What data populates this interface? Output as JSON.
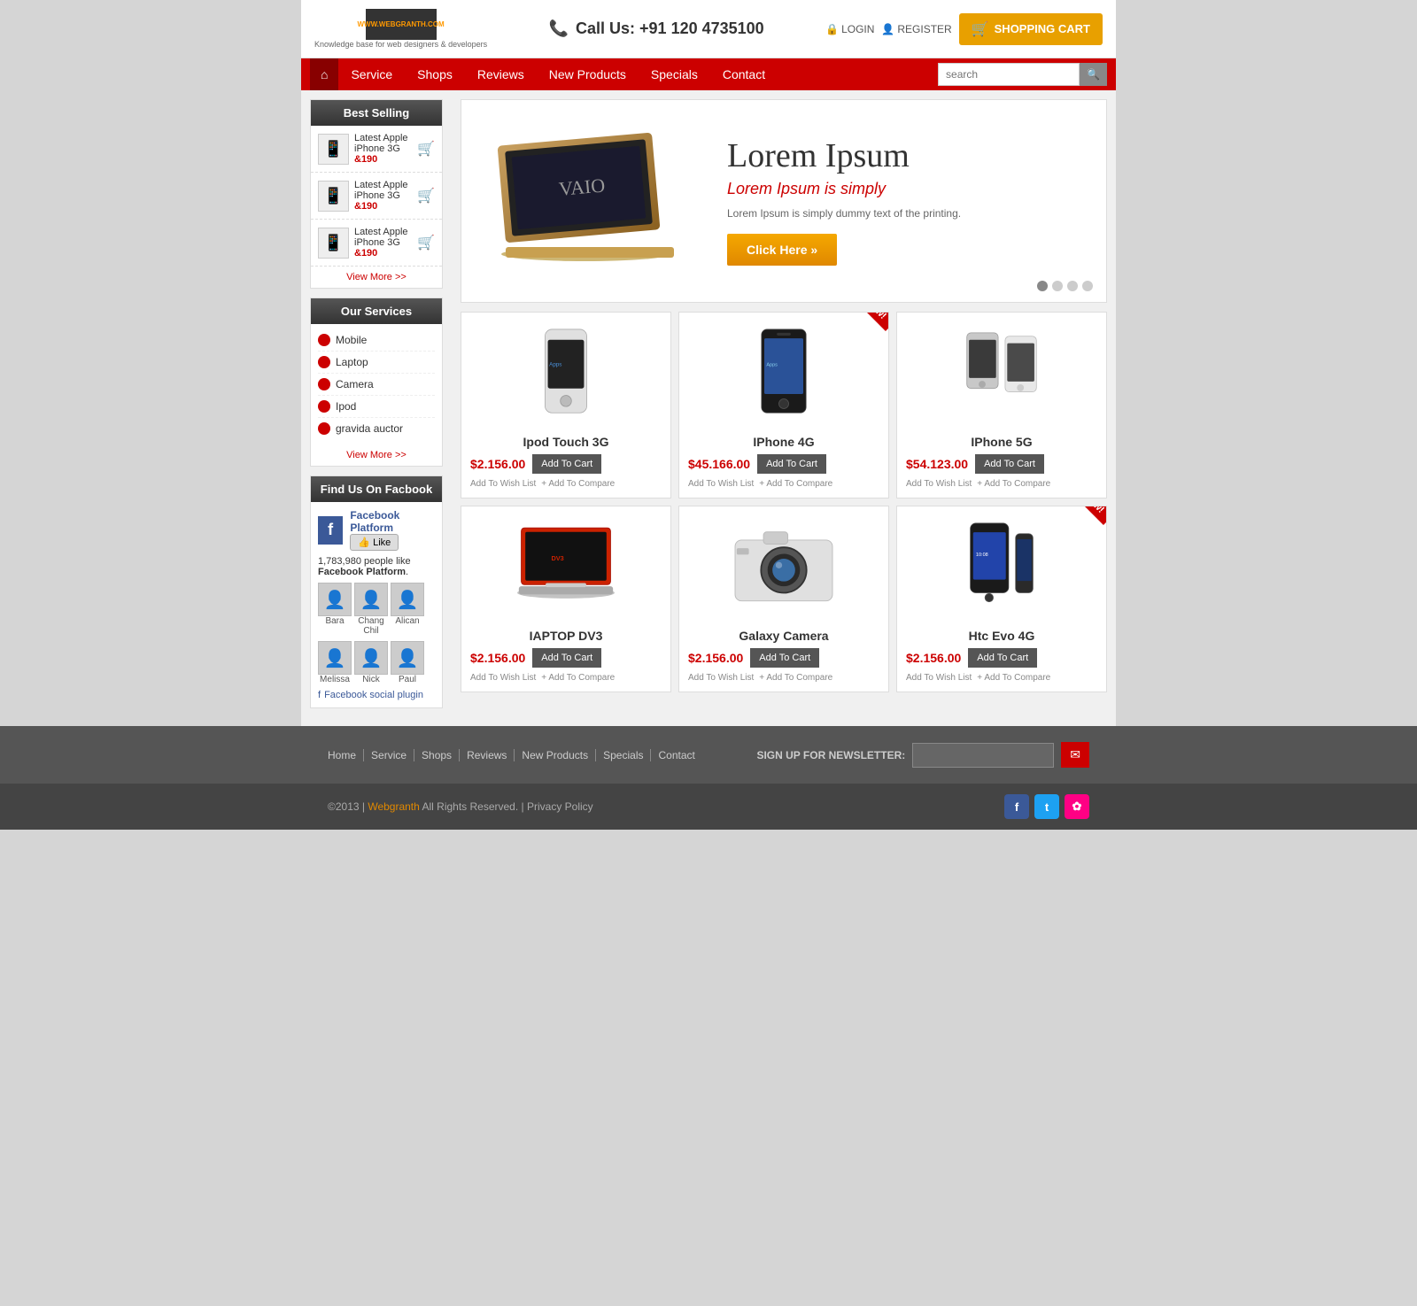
{
  "site": {
    "logo_text": "WWW.WEBGRANTH.COM",
    "logo_sub": "Knowledge base for web designers & developers",
    "phone_label": "Call Us:",
    "phone_number": "+91 120 4735100"
  },
  "header": {
    "login_label": "LOGIN",
    "register_label": "REGISTER",
    "cart_label": "SHOPPING CART"
  },
  "nav": {
    "home_label": "⌂",
    "items": [
      {
        "label": "Service",
        "href": "#"
      },
      {
        "label": "Shops",
        "href": "#"
      },
      {
        "label": "Reviews",
        "href": "#"
      },
      {
        "label": "New Products",
        "href": "#"
      },
      {
        "label": "Specials",
        "href": "#"
      },
      {
        "label": "Contact",
        "href": "#"
      }
    ],
    "search_placeholder": "search"
  },
  "sidebar": {
    "best_selling_title": "Best Selling",
    "best_selling_items": [
      {
        "name": "Latest Apple iPhone 3G",
        "price": "&190"
      },
      {
        "name": "Latest Apple iPhone 3G",
        "price": "&190"
      },
      {
        "name": "Latest Apple iPhone 3G",
        "price": "&190"
      }
    ],
    "view_more": "View More >>",
    "our_services_title": "Our Services",
    "services": [
      {
        "label": "Mobile"
      },
      {
        "label": "Laptop"
      },
      {
        "label": "Camera"
      },
      {
        "label": "Ipod"
      },
      {
        "label": "gravida auctor"
      }
    ],
    "services_view_more": "View More >>",
    "facebook_title": "Find Us On Facbook",
    "facebook_page": "Facebook Platform",
    "facebook_like": "Like",
    "facebook_count": "1,783,980 people like",
    "facebook_page_name": "Facebook Platform",
    "facebook_avatars": [
      {
        "name": "Bara"
      },
      {
        "name": "Chang Chil"
      },
      {
        "name": "Alican"
      },
      {
        "name": "Melissa"
      },
      {
        "name": "Nick"
      },
      {
        "name": "Paul"
      }
    ],
    "facebook_plugin": "Facebook social plugin"
  },
  "banner": {
    "title": "Lorem Ipsum",
    "subtitle": "Lorem Ipsum is simply",
    "description": "Lorem Ipsum is simply dummy text of the printing.",
    "cta_label": "Click Here »",
    "dots": 4
  },
  "products": [
    {
      "name": "Ipod Touch 3G",
      "price": "$2.156.00",
      "cart_label": "Add To Cart",
      "wish_label": "Add To Wish List",
      "compare_label": "+ Add To Compare",
      "is_new": false,
      "type": "ipod"
    },
    {
      "name": "IPhone 4G",
      "price": "$45.166.00",
      "cart_label": "Add To Cart",
      "wish_label": "Add To Wish List",
      "compare_label": "+ Add To Compare",
      "is_new": true,
      "type": "iphone4"
    },
    {
      "name": "IPhone 5G",
      "price": "$54.123.00",
      "cart_label": "Add To Cart",
      "wish_label": "Add To Wish List",
      "compare_label": "+ Add To Compare",
      "is_new": false,
      "type": "iphone5"
    },
    {
      "name": "IAPTOP DV3",
      "price": "$2.156.00",
      "cart_label": "Add To Cart",
      "wish_label": "Add To Wish List",
      "compare_label": "+ Add To Compare",
      "is_new": false,
      "type": "laptop"
    },
    {
      "name": "Galaxy Camera",
      "price": "$2.156.00",
      "cart_label": "Add To Cart",
      "wish_label": "Add To Wish List",
      "compare_label": "+ Add To Compare",
      "is_new": false,
      "type": "camera"
    },
    {
      "name": "Htc Evo 4G",
      "price": "$2.156.00",
      "cart_label": "Add To Cart",
      "wish_label": "Add To Wish List",
      "compare_label": "+ Add To Compare",
      "is_new": true,
      "type": "htc"
    }
  ],
  "footer": {
    "links": [
      "Home",
      "Service",
      "Shops",
      "Reviews",
      "New Products",
      "Specials",
      "Contact"
    ],
    "newsletter_label": "SIGN UP FOR NEWSLETTER:",
    "newsletter_placeholder": "",
    "copyright": "©2013 | ",
    "brand": "Webgranth",
    "rights": " All Rights Reserved. | Privacy Policy"
  }
}
